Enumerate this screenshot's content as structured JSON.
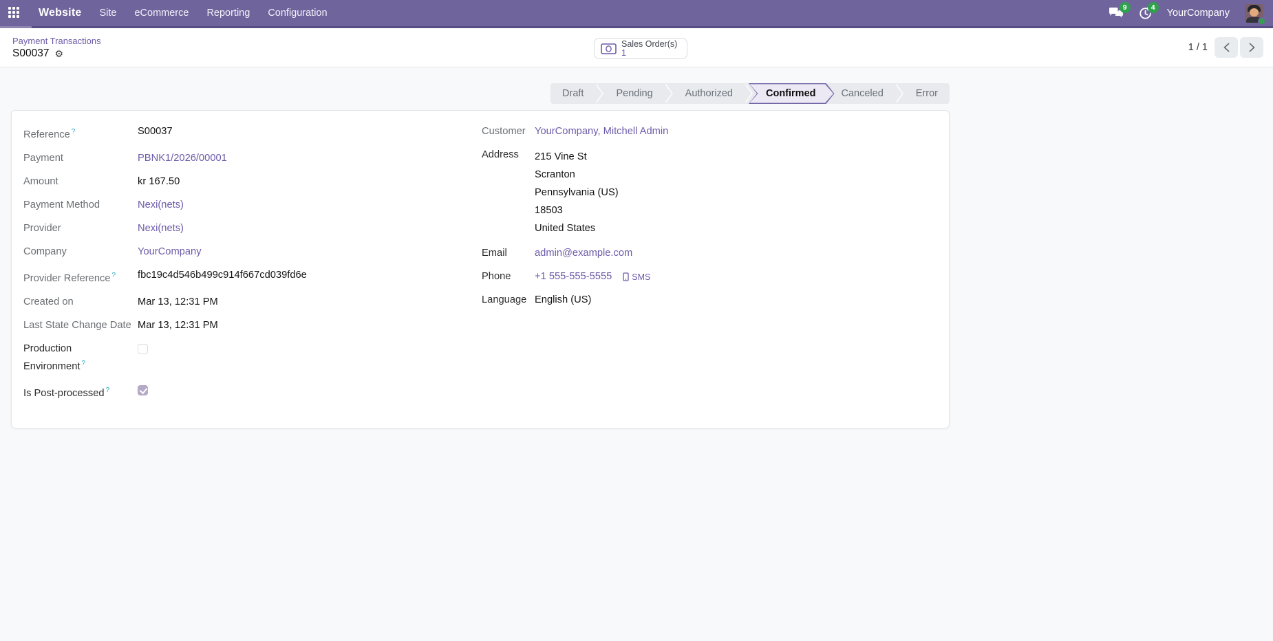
{
  "navbar": {
    "app_name": "Website",
    "menus": [
      {
        "id": "site",
        "label": "Site"
      },
      {
        "id": "ecommerce",
        "label": "eCommerce"
      },
      {
        "id": "reporting",
        "label": "Reporting"
      },
      {
        "id": "configuration",
        "label": "Configuration"
      }
    ],
    "messages_badge": "9",
    "activities_badge": "4",
    "company": "YourCompany"
  },
  "breadcrumb": {
    "parent": "Payment Transactions",
    "current": "S00037"
  },
  "stat_button": {
    "label": "Sales Order(s)",
    "count": "1"
  },
  "pager": {
    "value": "1 / 1"
  },
  "statusbar": {
    "states": [
      "Draft",
      "Pending",
      "Authorized",
      "Confirmed",
      "Canceled",
      "Error"
    ],
    "active": "Confirmed"
  },
  "help_marker": "?",
  "fields_left": [
    {
      "name": "reference",
      "label": "Reference",
      "help": true,
      "label_style": "muted",
      "type": "text",
      "value": "S00037"
    },
    {
      "name": "payment",
      "label": "Payment",
      "help": false,
      "label_style": "muted",
      "type": "link",
      "value": "PBNK1/2026/00001"
    },
    {
      "name": "amount",
      "label": "Amount",
      "help": false,
      "label_style": "muted",
      "type": "text",
      "value": "kr 167.50"
    },
    {
      "name": "payment-method",
      "label": "Payment Method",
      "help": false,
      "label_style": "muted",
      "type": "link",
      "value": "Nexi(nets)"
    },
    {
      "name": "provider",
      "label": "Provider",
      "help": false,
      "label_style": "muted",
      "type": "link",
      "value": "Nexi(nets)"
    },
    {
      "name": "company",
      "label": "Company",
      "help": false,
      "label_style": "muted",
      "type": "link",
      "value": "YourCompany"
    },
    {
      "name": "provider-reference",
      "label": "Provider Reference",
      "help": true,
      "label_style": "muted",
      "type": "text",
      "value": "fbc19c4d546b499c914f667cd039fd6e"
    },
    {
      "name": "created-on",
      "label": "Created on",
      "help": false,
      "label_style": "muted",
      "type": "text",
      "value": "Mar 13, 12:31 PM"
    },
    {
      "name": "last-state-change-date",
      "label": "Last State Change Date",
      "help": false,
      "label_style": "muted",
      "type": "text",
      "value": "Mar 13, 12:31 PM"
    },
    {
      "name": "production-environment",
      "label": "Production Environment",
      "help": true,
      "label_style": "dark",
      "type": "checkbox",
      "checked": false
    },
    {
      "name": "is-post-processed",
      "label": "Is Post-processed",
      "help": true,
      "label_style": "dark",
      "type": "checkbox",
      "checked": true
    }
  ],
  "fields_right": [
    {
      "name": "customer",
      "label": "Customer",
      "help": false,
      "label_style": "muted",
      "type": "link",
      "value": "YourCompany, Mitchell Admin"
    },
    {
      "name": "address",
      "label": "Address",
      "help": false,
      "label_style": "dark",
      "type": "multiline",
      "lines": [
        "215 Vine St",
        "Scranton",
        "Pennsylvania (US)",
        "18503",
        "United States"
      ]
    },
    {
      "name": "email",
      "label": "Email",
      "help": false,
      "label_style": "dark",
      "type": "link",
      "value": "admin@example.com"
    },
    {
      "name": "phone",
      "label": "Phone",
      "help": false,
      "label_style": "dark",
      "type": "phone",
      "value": "+1 555-555-5555",
      "sms_label": "SMS"
    },
    {
      "name": "language",
      "label": "Language",
      "help": false,
      "label_style": "dark",
      "type": "text",
      "value": "English (US)"
    }
  ],
  "colors": {
    "navbar": "#6f659c",
    "accent_link": "#6d5ba8",
    "badge_green": "#2fa24c",
    "statusbar_bg": "#e8eaee",
    "active_state_bg": "#ece8f4",
    "active_state_border": "#7567a8"
  }
}
